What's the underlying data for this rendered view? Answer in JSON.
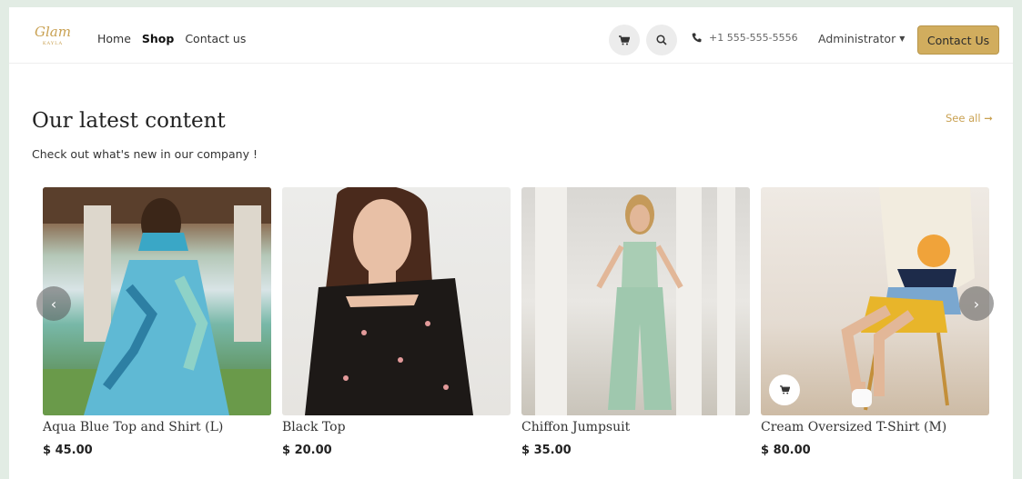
{
  "header": {
    "logo_text": "Glam",
    "logo_sub": "KAYLA",
    "nav": [
      {
        "label": "Home",
        "active": false
      },
      {
        "label": "Shop",
        "active": true
      },
      {
        "label": "Contact us",
        "active": false
      }
    ],
    "phone": "+1 555-555-5556",
    "user": "Administrator",
    "contact_button": "Contact Us"
  },
  "section": {
    "title": "Our latest content",
    "subtitle": "Check out what's new in our company !",
    "see_all": "See all"
  },
  "products": [
    {
      "name": "Aqua Blue Top and Shirt (L)",
      "price": "$ 45.00"
    },
    {
      "name": "Black Top",
      "price": "$ 20.00"
    },
    {
      "name": "Chiffon Jumpsuit",
      "price": "$ 35.00"
    },
    {
      "name": "Cream Oversized T-Shirt (M)",
      "price": "$ 80.00"
    }
  ],
  "colors": {
    "accent": "#d1ad5e",
    "background": "#e2ece4"
  },
  "icons": [
    "cart-icon",
    "search-icon",
    "phone-icon",
    "chevron-left-icon",
    "chevron-right-icon",
    "arrow-right-icon"
  ]
}
